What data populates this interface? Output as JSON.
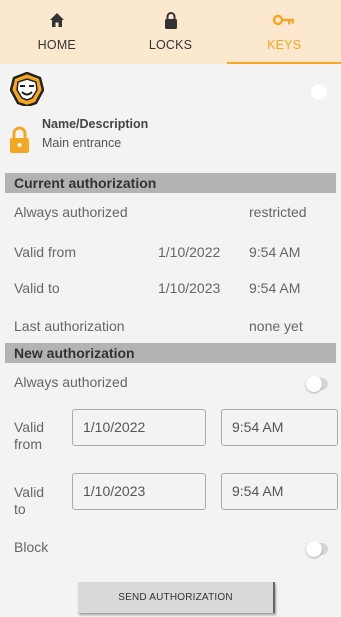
{
  "nav": {
    "tabs": [
      {
        "label": "HOME",
        "icon": "home-icon"
      },
      {
        "label": "LOCKS",
        "icon": "padlock-icon"
      },
      {
        "label": "KEYS",
        "icon": "key-icon",
        "active": true
      }
    ],
    "active_color": "#f5a623",
    "background": "#fbe8cf"
  },
  "lock": {
    "name_label": "Name/Description",
    "name_value": "Main entrance"
  },
  "current_authorization": {
    "title": "Current authorization",
    "always_authorized_label": "Always authorized",
    "always_authorized_value": "restricted",
    "valid_from_label": "Valid from",
    "valid_from_date": "1/10/2022",
    "valid_from_time": "9:54 AM",
    "valid_to_label": "Valid to",
    "valid_to_date": "1/10/2023",
    "valid_to_time": "9:54 AM",
    "last_authorization_label": "Last authorization",
    "last_authorization_value": "none yet"
  },
  "new_authorization": {
    "title": "New authorization",
    "always_authorized_label": "Always authorized",
    "always_authorized_on": false,
    "valid_from_label_1": "Valid",
    "valid_from_label_2": "from",
    "valid_from_date": "1/10/2022",
    "valid_from_time": "9:54 AM",
    "valid_to_label_1": "Valid",
    "valid_to_label_2": "to",
    "valid_to_date": "1/10/2023",
    "valid_to_time": "9:54 AM",
    "block_label": "Block",
    "block_on": false
  },
  "send_button_label": "SEND AUTHORIZATION"
}
